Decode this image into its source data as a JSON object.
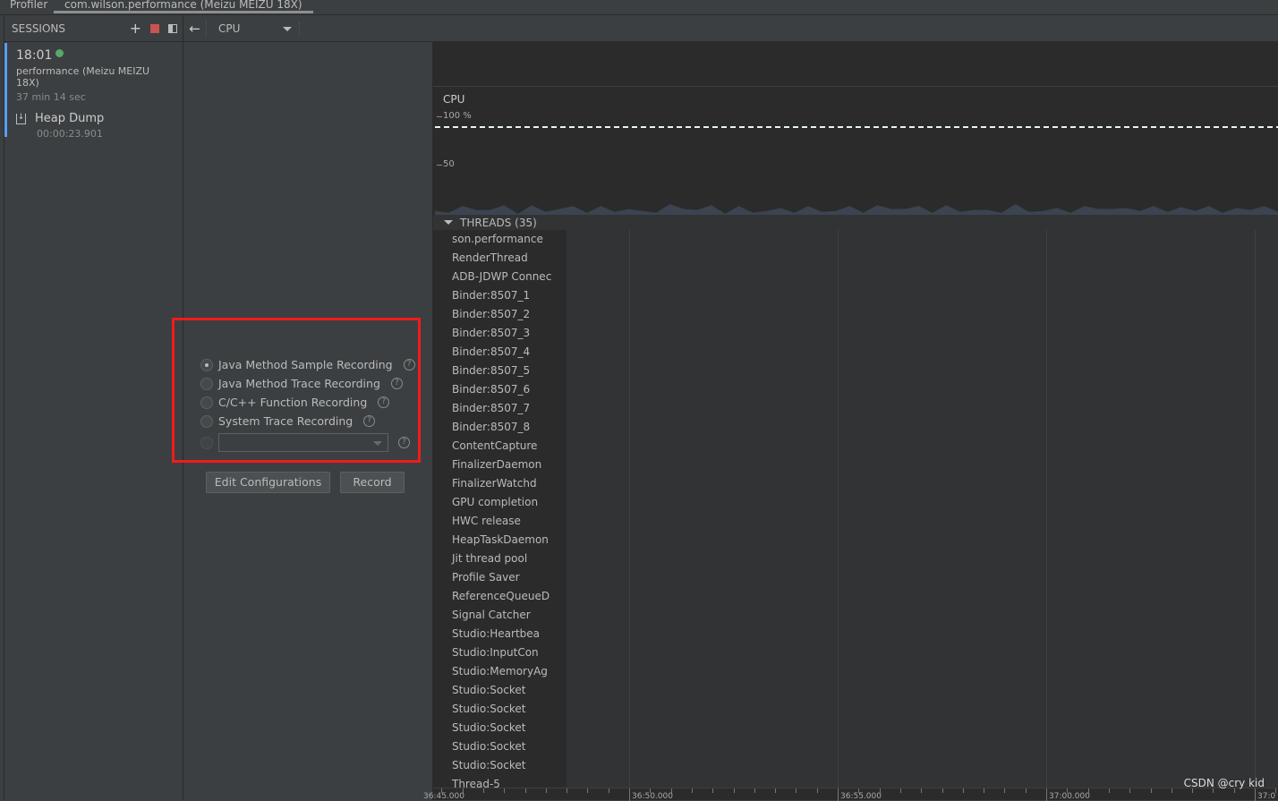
{
  "tabs": [
    "Profiler",
    "com.wilson.performance (Meizu MEIZU 18X)"
  ],
  "sessions": {
    "title": "SESSIONS",
    "item": {
      "time": "18:01",
      "name": "performance (Meizu MEIZU 18X)",
      "duration": "37 min 14 sec",
      "status_color": "#59a869"
    },
    "artifact": {
      "label": "Heap Dump",
      "time": "00:00:23.901"
    }
  },
  "toolbar": {
    "back_icon": "arrow-left-icon",
    "profiler_select": "CPU"
  },
  "recording": {
    "options": [
      {
        "label": "Java Method Sample Recording",
        "selected": true
      },
      {
        "label": "Java Method Trace Recording",
        "selected": false
      },
      {
        "label": "C/C++ Function Recording",
        "selected": false
      },
      {
        "label": "System Trace Recording",
        "selected": false
      }
    ],
    "help": "?",
    "edit_label": "Edit Configurations",
    "record_label": "Record"
  },
  "chart_data": {
    "type": "area",
    "title": "CPU",
    "y_ticks": [
      "100 %",
      "50"
    ],
    "ylim": [
      0,
      100
    ],
    "values": [
      4,
      2,
      9,
      5,
      5,
      10,
      1,
      10,
      3,
      6,
      9,
      2,
      9,
      3,
      6,
      4,
      2,
      11,
      6,
      5,
      10,
      1,
      9,
      2,
      4,
      7,
      2,
      9,
      3,
      4,
      9,
      2,
      10,
      6,
      6,
      9,
      2,
      10,
      3,
      5,
      5,
      2,
      11,
      3,
      4,
      7,
      2,
      9,
      6,
      6,
      7,
      4,
      9,
      3,
      8,
      4,
      9,
      2,
      7,
      5,
      9,
      3
    ]
  },
  "threads": {
    "header": "THREADS (35)",
    "names": [
      "son.performance",
      "RenderThread",
      "ADB-JDWP Connec",
      "Binder:8507_1",
      "Binder:8507_2",
      "Binder:8507_3",
      "Binder:8507_4",
      "Binder:8507_5",
      "Binder:8507_6",
      "Binder:8507_7",
      "Binder:8507_8",
      "ContentCapture",
      "FinalizerDaemon",
      "FinalizerWatchd",
      "GPU completion",
      "HWC release",
      "HeapTaskDaemon",
      "Jit thread pool",
      "Profile Saver",
      "ReferenceQueueD",
      "Signal Catcher",
      "Studio:Heartbea",
      "Studio:InputCon",
      "Studio:MemoryAg",
      "Studio:Socket",
      "Studio:Socket",
      "Studio:Socket",
      "Studio:Socket",
      "Studio:Socket",
      "Thread-5"
    ]
  },
  "timeline": {
    "labels": [
      "36:45.000",
      "36:50.000",
      "36:55.000",
      "37:00.000",
      "37:0"
    ]
  },
  "watermark": "CSDN @cry kid"
}
